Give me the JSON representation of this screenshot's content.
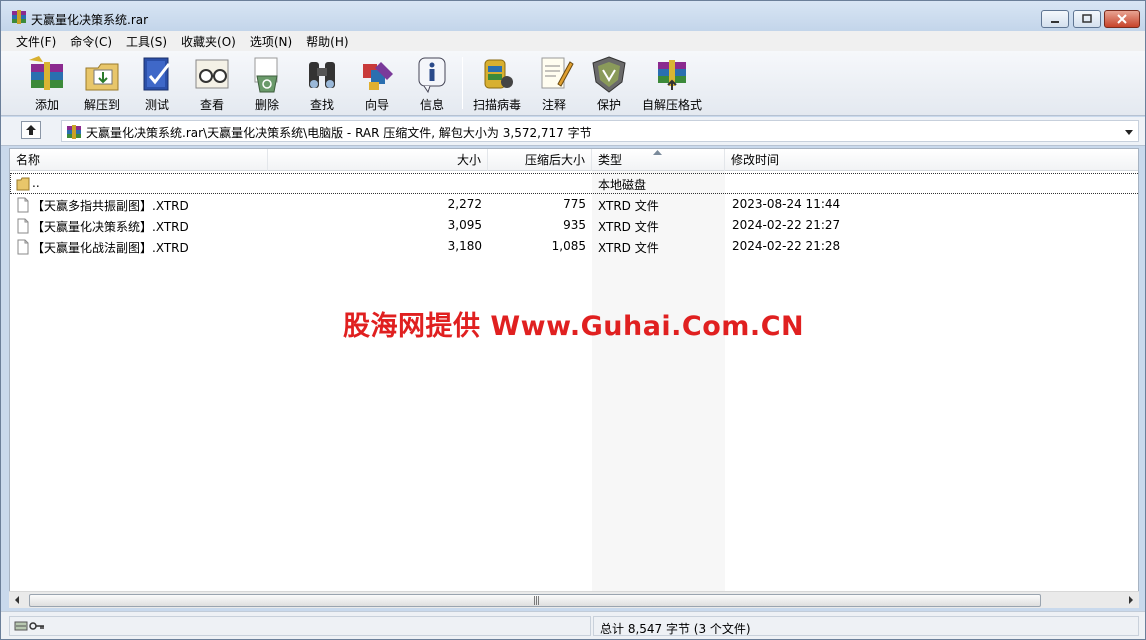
{
  "window": {
    "title": "天赢量化决策系统.rar"
  },
  "menu": [
    "文件(F)",
    "命令(C)",
    "工具(S)",
    "收藏夹(O)",
    "选项(N)",
    "帮助(H)"
  ],
  "toolbar": {
    "add": "添加",
    "extract_to": "解压到",
    "test": "测试",
    "view": "查看",
    "delete": "删除",
    "find": "查找",
    "wizard": "向导",
    "info": "信息",
    "virus_scan": "扫描病毒",
    "comment": "注释",
    "protect": "保护",
    "sfx": "自解压格式"
  },
  "address": {
    "text": "天赢量化决策系统.rar\\天赢量化决策系统\\电脑版 - RAR 压缩文件, 解包大小为 3,572,717 字节"
  },
  "columns": {
    "name": "名称",
    "size": "大小",
    "packed": "压缩后大小",
    "type": "类型",
    "mtime": "修改时间"
  },
  "rows": [
    {
      "name": "..",
      "size": "",
      "packed": "",
      "type": "本地磁盘",
      "mtime": ""
    },
    {
      "name": "【天赢多指共振副图】.XTRD",
      "size": "2,272",
      "packed": "775",
      "type": "XTRD 文件",
      "mtime": "2023-08-24 11:44"
    },
    {
      "name": "【天赢量化决策系统】.XTRD",
      "size": "3,095",
      "packed": "935",
      "type": "XTRD 文件",
      "mtime": "2024-02-22 21:27"
    },
    {
      "name": "【天赢量化战法副图】.XTRD",
      "size": "3,180",
      "packed": "1,085",
      "type": "XTRD 文件",
      "mtime": "2024-02-22 21:28"
    }
  ],
  "watermark": "股海网提供 Www.Guhai.Com.CN",
  "status": {
    "right": "总计 8,547 字节 (3 个文件)"
  },
  "colors": {
    "watermark": "#e02020",
    "window_frame": "#c9d9ec"
  }
}
